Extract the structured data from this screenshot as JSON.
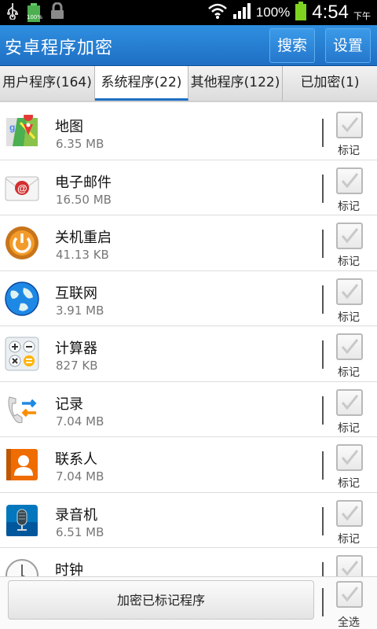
{
  "status_bar": {
    "usb_icon": "usb-icon",
    "battery_small_text": "100%",
    "battery_percent": "100%",
    "time": "4:54",
    "ampm": "下午"
  },
  "header": {
    "title": "安卓程序加密",
    "search_label": "搜索",
    "settings_label": "设置",
    "color": "#1f6fc4"
  },
  "tabs": [
    {
      "label": "用户程序(164)",
      "active": false
    },
    {
      "label": "系统程序(22)",
      "active": true
    },
    {
      "label": "其他程序(122)",
      "active": false
    },
    {
      "label": "已加密(1)",
      "active": false
    }
  ],
  "apps": [
    {
      "name": "地图",
      "size": "6.35 MB",
      "icon": "maps-icon",
      "mark": "标记"
    },
    {
      "name": "电子邮件",
      "size": "16.50 MB",
      "icon": "email-icon",
      "mark": "标记"
    },
    {
      "name": "关机重启",
      "size": "41.13 KB",
      "icon": "power-icon",
      "mark": "标记"
    },
    {
      "name": "互联网",
      "size": "3.91 MB",
      "icon": "globe-icon",
      "mark": "标记"
    },
    {
      "name": "计算器",
      "size": "827 KB",
      "icon": "calculator-icon",
      "mark": "标记"
    },
    {
      "name": "记录",
      "size": "7.04 MB",
      "icon": "call-log-icon",
      "mark": "标记"
    },
    {
      "name": "联系人",
      "size": "7.04 MB",
      "icon": "contacts-icon",
      "mark": "标记"
    },
    {
      "name": "录音机",
      "size": "6.51 MB",
      "icon": "recorder-icon",
      "mark": "标记"
    },
    {
      "name": "时钟",
      "size": "",
      "icon": "clock-icon",
      "mark": ""
    }
  ],
  "bottom": {
    "encrypt_label": "加密已标记程序",
    "select_all_label": "全选"
  }
}
